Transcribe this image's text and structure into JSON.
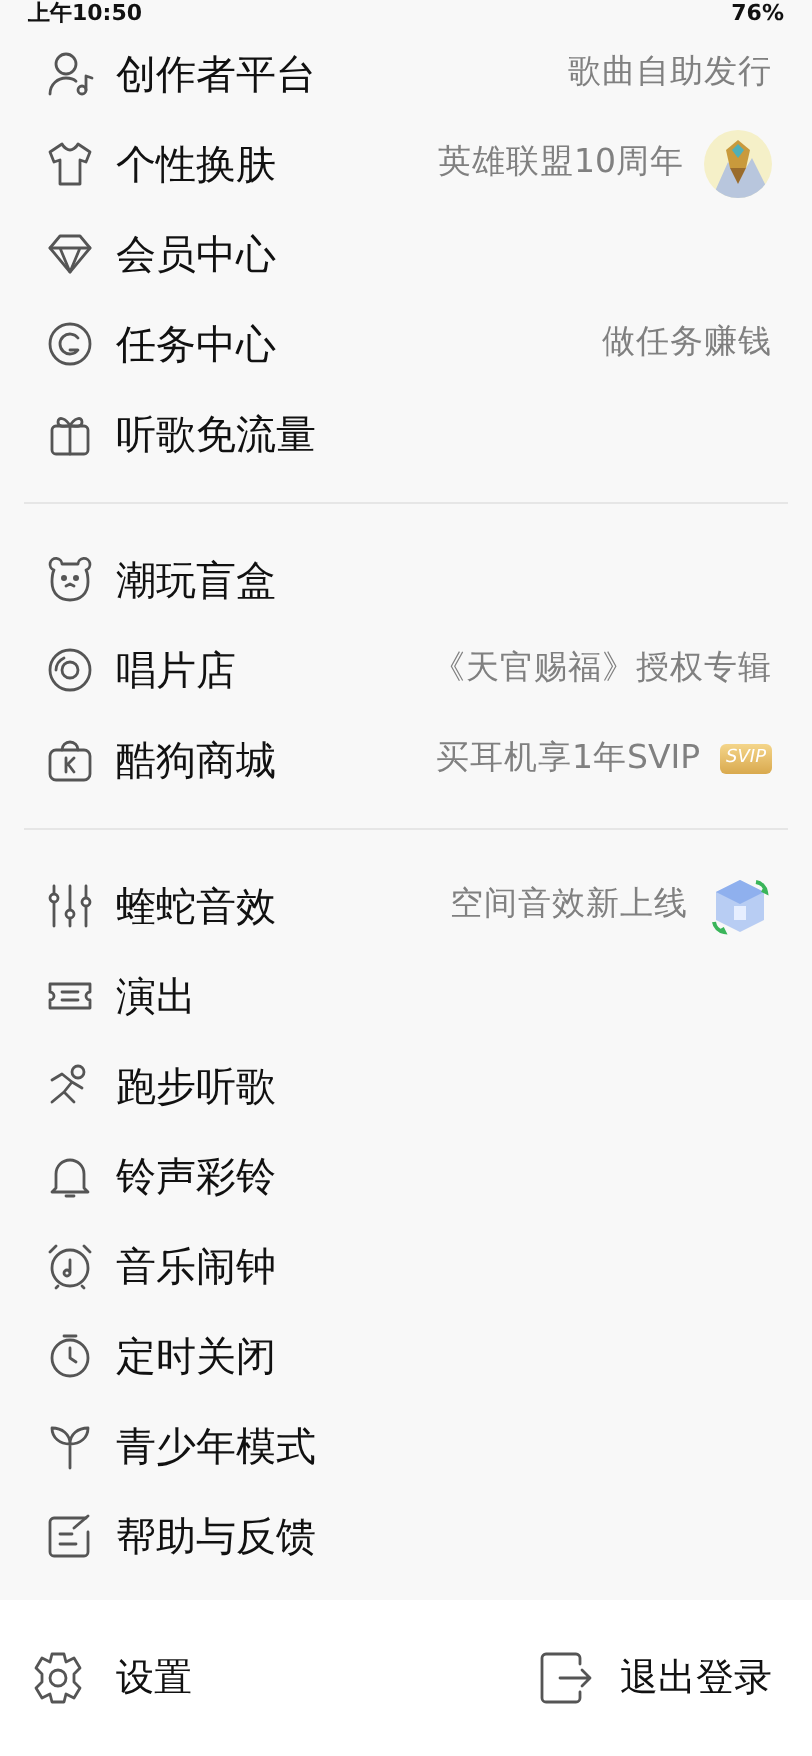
{
  "status_bar": {
    "time": "上午10:50",
    "battery": "76%"
  },
  "sections": [
    {
      "items": [
        {
          "label": "创作者平台",
          "detail": "歌曲自助发行"
        },
        {
          "label": "个性换肤",
          "detail": "英雄联盟10周年"
        },
        {
          "label": "会员中心"
        },
        {
          "label": "任务中心",
          "detail": "做任务赚钱"
        },
        {
          "label": "听歌免流量"
        }
      ]
    },
    {
      "items": [
        {
          "label": "潮玩盲盒"
        },
        {
          "label": "唱片店",
          "detail": "《天官赐福》授权专辑"
        },
        {
          "label": "酷狗商城",
          "detail": "买耳机享1年SVIP",
          "trailing": {
            "kind": "badge",
            "text": "SVIP"
          }
        }
      ]
    },
    {
      "items": [
        {
          "label": "蝰蛇音效",
          "detail": "空间音效新上线",
          "trailing": {
            "kind": "icon"
          }
        },
        {
          "label": "演出"
        },
        {
          "label": "跑步听歌"
        },
        {
          "label": "铃声彩铃"
        },
        {
          "label": "音乐闹钟"
        },
        {
          "label": "定时关闭"
        },
        {
          "label": "青少年模式"
        },
        {
          "label": "帮助与反馈"
        }
      ]
    }
  ],
  "footer": {
    "settings": "设置",
    "logout": "退出登录"
  }
}
